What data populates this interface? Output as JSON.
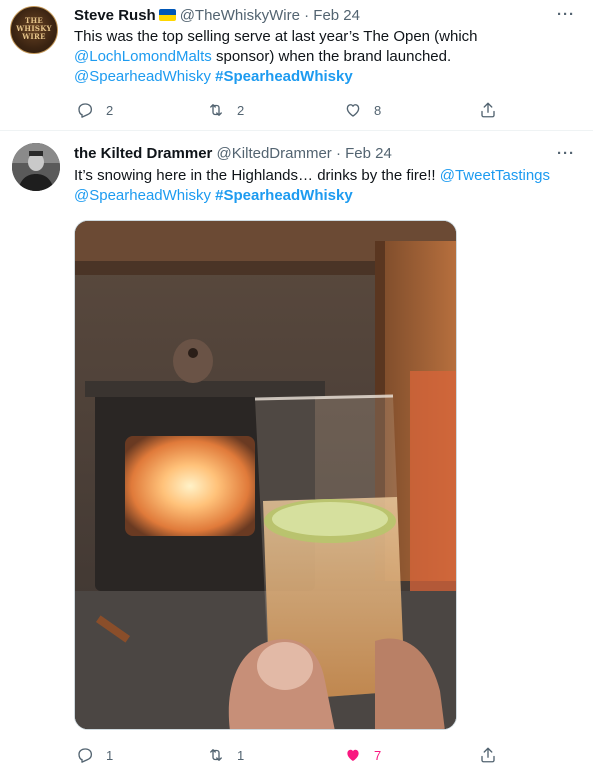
{
  "tweets": [
    {
      "author": {
        "name": "Steve Rush",
        "handle": "@TheWhiskyWire",
        "avatar_text": "THE WHISKY WIRE",
        "flag": "ukraine-flag"
      },
      "separator": "·",
      "date": "Feb 24",
      "text": {
        "p1": "This was the top selling serve at last year’s The Open (which",
        "mention1": "@LochLomondMalts",
        "p2": " sponsor) when the brand launched.",
        "mention2": "@SpearheadWhisky",
        "hashtag": "#SpearheadWhisky"
      },
      "actions": {
        "replies": "2",
        "retweets": "2",
        "likes": "8"
      }
    },
    {
      "author": {
        "name": "the Kilted Drammer",
        "handle": "@KiltedDrammer"
      },
      "separator": "·",
      "date": "Feb 24",
      "text": {
        "p1": "It’s snowing here in the Highlands… drinks by the fire!! ",
        "mention1": "@TweetTastings",
        "mention2": "@SpearheadWhisky",
        "hashtag": "#SpearheadWhisky"
      },
      "actions": {
        "replies": "1",
        "retweets": "1",
        "likes": "7",
        "liked": true
      }
    }
  ],
  "colors": {
    "link": "#1d9bf0",
    "muted": "#536471",
    "like_active": "#f91880"
  }
}
